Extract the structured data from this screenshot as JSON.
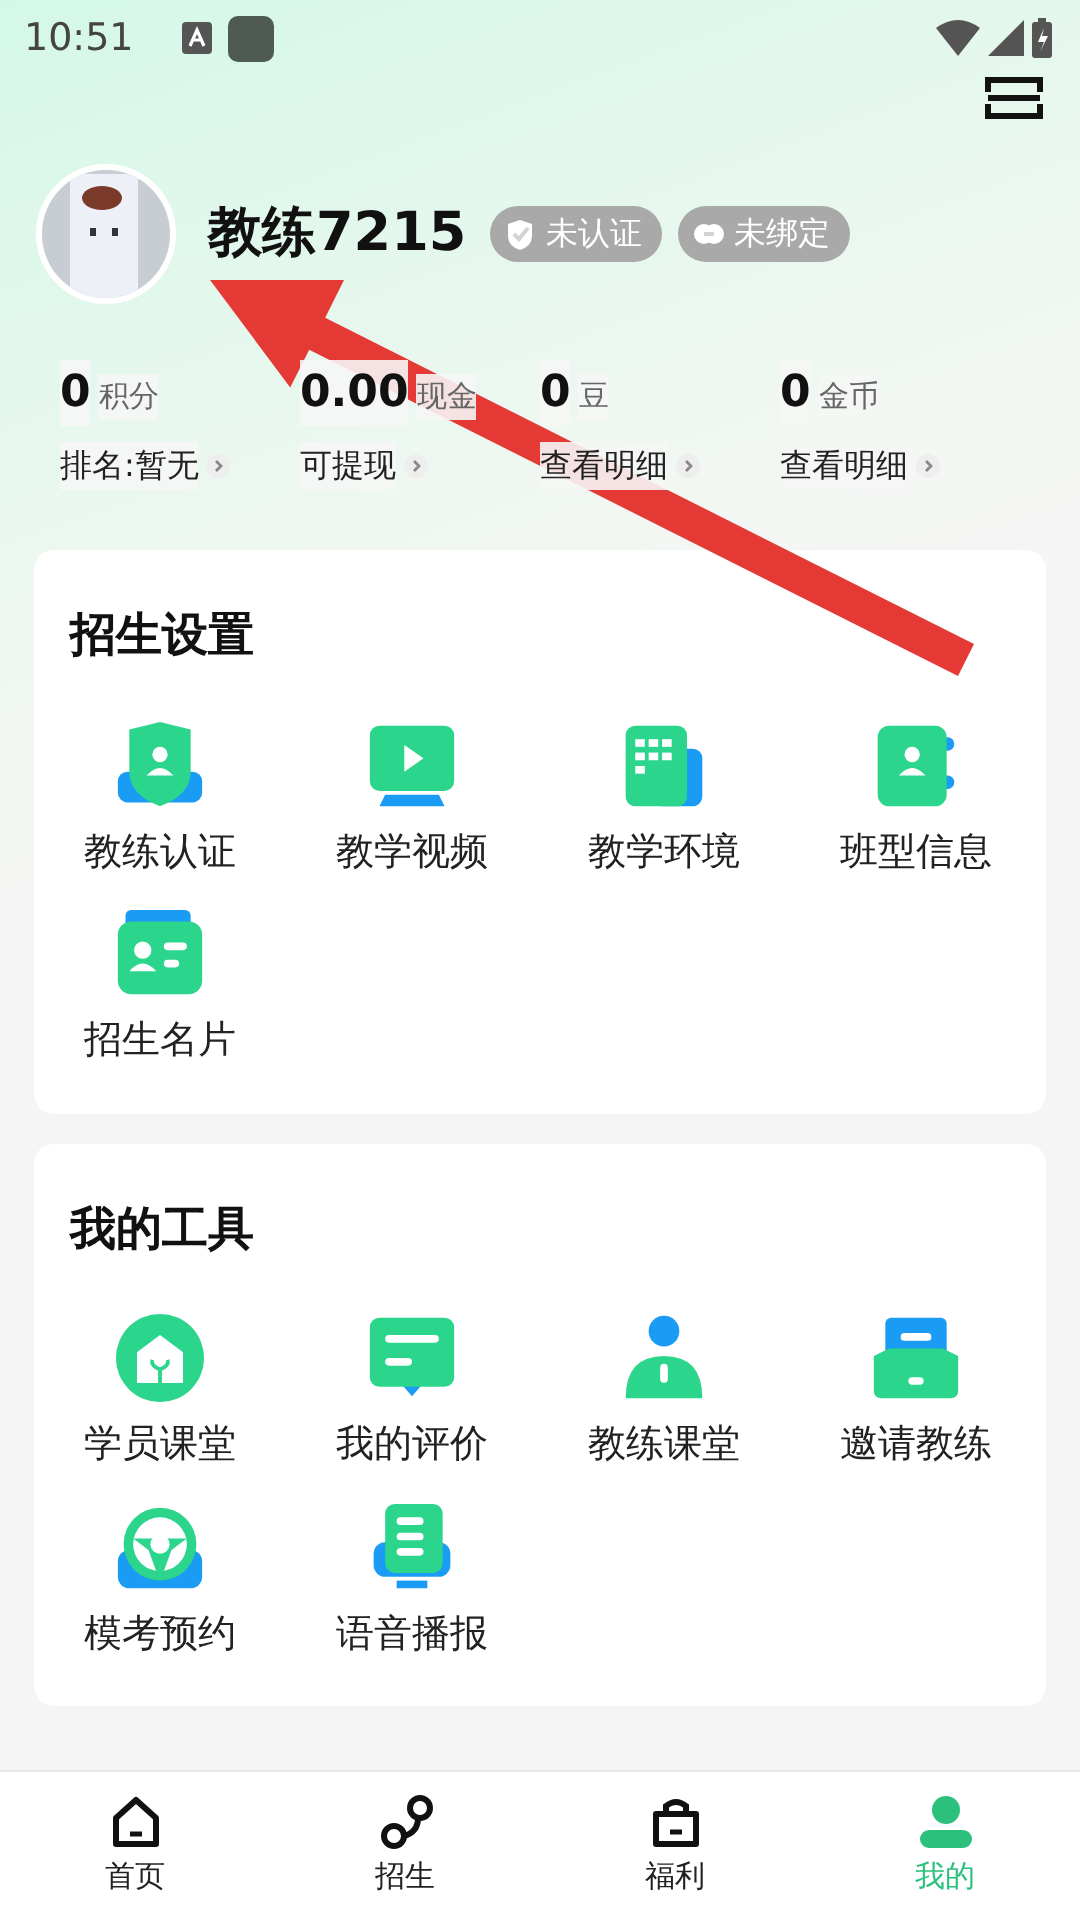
{
  "status_bar": {
    "time": "10:51"
  },
  "profile": {
    "name": "教练7215",
    "badges": [
      {
        "label": "未认证",
        "kind": "verify"
      },
      {
        "label": "未绑定",
        "kind": "link"
      }
    ]
  },
  "stats": [
    {
      "value": "0",
      "unit": "积分",
      "link": "排名:暂无"
    },
    {
      "value": "0.00",
      "unit": "现金",
      "link": "可提现"
    },
    {
      "value": "0",
      "unit": "豆",
      "link": "查看明细"
    },
    {
      "value": "0",
      "unit": "金币",
      "link": "查看明细"
    }
  ],
  "sections": [
    {
      "title": "招生设置",
      "items": [
        "教练认证",
        "教学视频",
        "教学环境",
        "班型信息",
        "招生名片"
      ]
    },
    {
      "title": "我的工具",
      "items": [
        "学员课堂",
        "我的评价",
        "教练课堂",
        "邀请教练",
        "模考预约",
        "语音播报"
      ]
    }
  ],
  "bottom_nav": [
    {
      "label": "首页",
      "selected": false
    },
    {
      "label": "招生",
      "selected": false
    },
    {
      "label": "福利",
      "selected": false
    },
    {
      "label": "我的",
      "selected": true
    }
  ]
}
